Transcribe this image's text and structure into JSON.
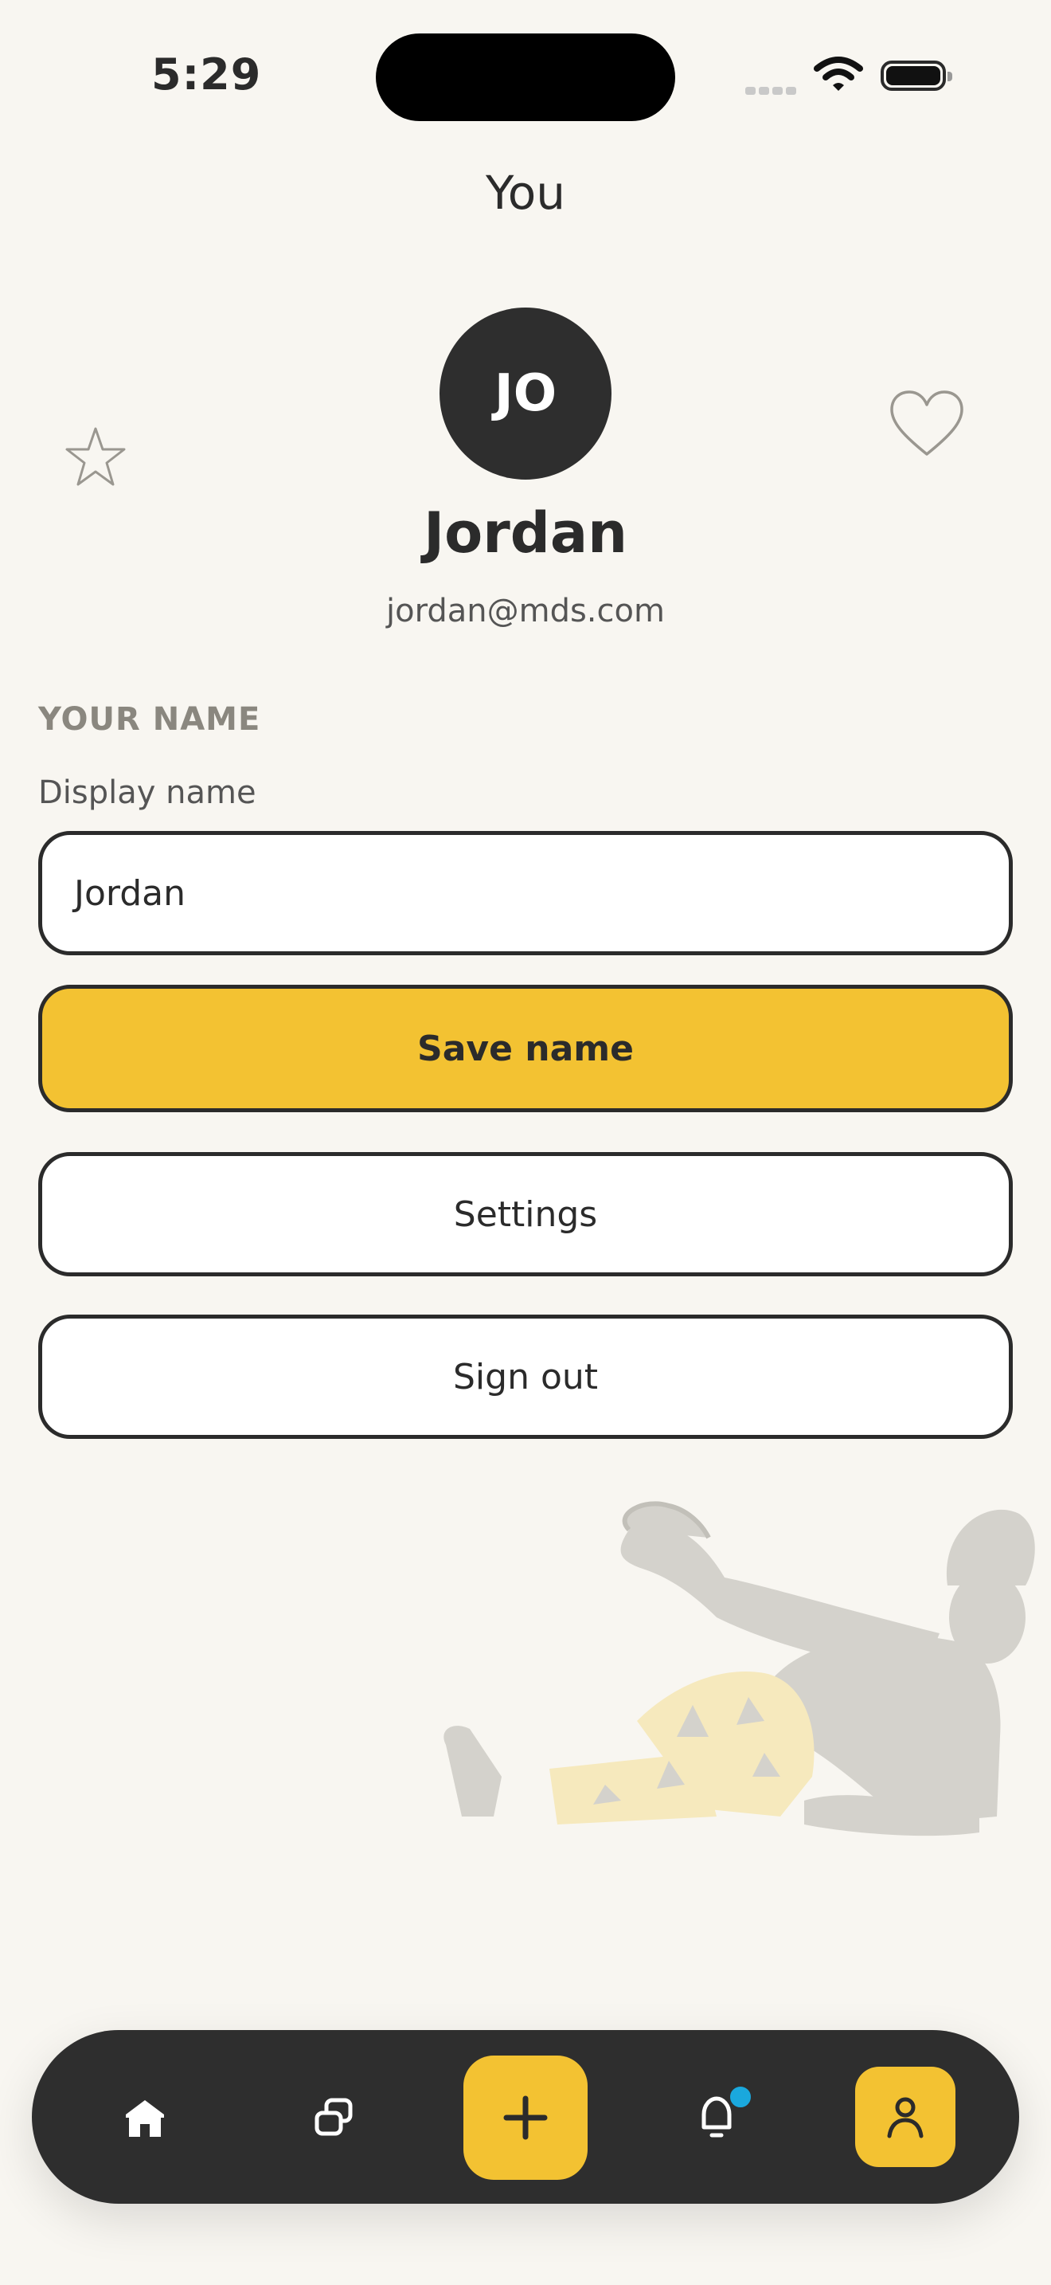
{
  "status_bar": {
    "time": "5:29"
  },
  "header": {
    "title": "You"
  },
  "profile": {
    "initials": "JO",
    "name": "Jordan",
    "email": "jordan@mds.com"
  },
  "name_section": {
    "section_label": "YOUR NAME",
    "field_label": "Display name",
    "field_value": "Jordan",
    "save_label": "Save name"
  },
  "actions": {
    "settings_label": "Settings",
    "signout_label": "Sign out"
  },
  "nav": {
    "items": [
      {
        "icon": "home-icon"
      },
      {
        "icon": "collections-icon"
      },
      {
        "icon": "plus-icon"
      },
      {
        "icon": "bell-icon",
        "badge": true
      },
      {
        "icon": "profile-icon",
        "active": true
      }
    ]
  },
  "colors": {
    "background": "#f8f6f1",
    "accent": "#f3c232",
    "dark": "#2e2e2e",
    "badge": "#1aa8dd"
  }
}
